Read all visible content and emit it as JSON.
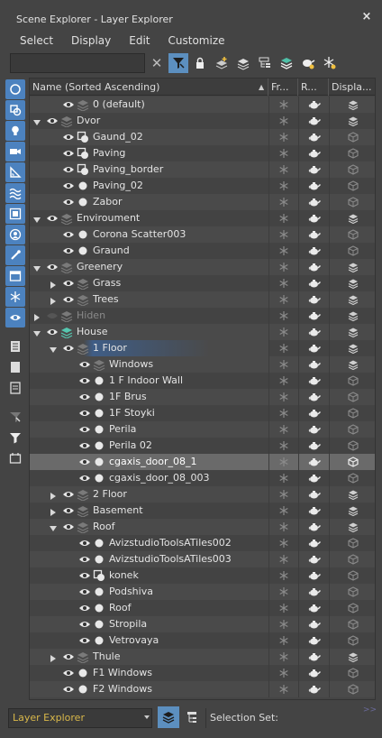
{
  "window": {
    "title": "Scene Explorer - Layer Explorer",
    "close": "×"
  },
  "menu": [
    "Select",
    "Display",
    "Edit",
    "Customize"
  ],
  "search": {
    "value": "",
    "placeholder": ""
  },
  "columns": {
    "name": "Name (Sorted Ascending)",
    "frozen": "Fr...",
    "render": "R...",
    "display": "Displa..."
  },
  "tree": [
    {
      "label": "0 (default)",
      "depth": 1,
      "expand": "none",
      "icon": "layer"
    },
    {
      "label": "Dvor",
      "depth": 0,
      "expand": "open",
      "icon": "layer"
    },
    {
      "label": "Gaund_02",
      "depth": 1,
      "expand": "none",
      "icon": "object-group"
    },
    {
      "label": "Paving",
      "depth": 1,
      "expand": "none",
      "icon": "object-group"
    },
    {
      "label": "Paving_border",
      "depth": 1,
      "expand": "none",
      "icon": "object-group"
    },
    {
      "label": "Paving_02",
      "depth": 1,
      "expand": "none",
      "icon": "object"
    },
    {
      "label": "Zabor",
      "depth": 1,
      "expand": "none",
      "icon": "object"
    },
    {
      "label": "Enviroument",
      "depth": 0,
      "expand": "open",
      "icon": "layer"
    },
    {
      "label": "Corona Scatter003",
      "depth": 1,
      "expand": "none",
      "icon": "object"
    },
    {
      "label": "Graund",
      "depth": 1,
      "expand": "none",
      "icon": "object"
    },
    {
      "label": "Greenery",
      "depth": 0,
      "expand": "open",
      "icon": "layer"
    },
    {
      "label": "Grass",
      "depth": 1,
      "expand": "closed",
      "icon": "layer"
    },
    {
      "label": "Trees",
      "depth": 1,
      "expand": "closed",
      "icon": "layer"
    },
    {
      "label": "Hiden",
      "depth": 0,
      "expand": "closed",
      "icon": "layer",
      "dim": true
    },
    {
      "label": "House",
      "depth": 0,
      "expand": "open",
      "icon": "layer-active"
    },
    {
      "label": "1 Floor",
      "depth": 1,
      "expand": "open",
      "icon": "layer",
      "selected": true
    },
    {
      "label": "Windows",
      "depth": 2,
      "expand": "none",
      "icon": "layer"
    },
    {
      "label": "1 F Indoor Wall",
      "depth": 2,
      "expand": "none",
      "icon": "object"
    },
    {
      "label": "1F Brus",
      "depth": 2,
      "expand": "none",
      "icon": "object"
    },
    {
      "label": "1F Stoyki",
      "depth": 2,
      "expand": "none",
      "icon": "object"
    },
    {
      "label": "Perila",
      "depth": 2,
      "expand": "none",
      "icon": "object"
    },
    {
      "label": "Perila 02",
      "depth": 2,
      "expand": "none",
      "icon": "object"
    },
    {
      "label": "cgaxis_door_08_1",
      "depth": 2,
      "expand": "none",
      "icon": "object",
      "highlight": true
    },
    {
      "label": "cgaxis_door_08_003",
      "depth": 2,
      "expand": "none",
      "icon": "object"
    },
    {
      "label": "2 Floor",
      "depth": 1,
      "expand": "closed",
      "icon": "layer"
    },
    {
      "label": "Basement",
      "depth": 1,
      "expand": "closed",
      "icon": "layer"
    },
    {
      "label": "Roof",
      "depth": 1,
      "expand": "open",
      "icon": "layer"
    },
    {
      "label": "AvizstudioToolsATiles002",
      "depth": 2,
      "expand": "none",
      "icon": "object"
    },
    {
      "label": "AvizstudioToolsATiles003",
      "depth": 2,
      "expand": "none",
      "icon": "object"
    },
    {
      "label": "konek",
      "depth": 2,
      "expand": "none",
      "icon": "object-group"
    },
    {
      "label": "Podshiva",
      "depth": 2,
      "expand": "none",
      "icon": "object"
    },
    {
      "label": "Roof",
      "depth": 2,
      "expand": "none",
      "icon": "object"
    },
    {
      "label": "Stropila",
      "depth": 2,
      "expand": "none",
      "icon": "object"
    },
    {
      "label": "Vetrovaya",
      "depth": 2,
      "expand": "none",
      "icon": "object"
    },
    {
      "label": "Thule",
      "depth": 1,
      "expand": "closed",
      "icon": "layer"
    },
    {
      "label": "F1 Windows",
      "depth": 1,
      "expand": "none",
      "icon": "object"
    },
    {
      "label": "F2 Windows",
      "depth": 1,
      "expand": "none",
      "icon": "object"
    }
  ],
  "bottom": {
    "explorer_combo": "Layer Explorer",
    "selection_set": "Selection Set:",
    "corner": ">>"
  },
  "colors": {
    "accent": "#5c8fbf",
    "selection": "#3f5d86",
    "highlight_row": "#6a6a6a",
    "combo_text": "#d9b84a"
  }
}
